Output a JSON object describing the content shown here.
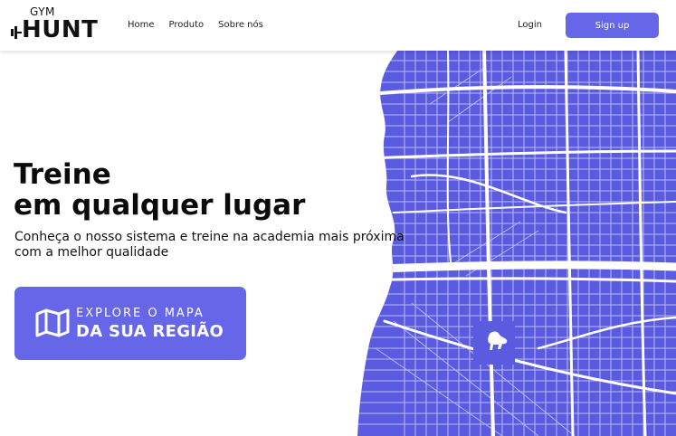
{
  "header": {
    "logo_top": "GYM",
    "logo_bottom": "HUNT",
    "nav": [
      "Home",
      "Produto",
      "Sobre nós"
    ],
    "login_label": "Login",
    "signup_label": "Sign up"
  },
  "hero": {
    "headline_line1": "Treine",
    "headline_line2": "em qualquer lugar",
    "subtitle": "Conheça o nosso sistema e treine na academia mais próxima com a melhor qualidade",
    "cta_line1": "EXPLORE O MAPA",
    "cta_line2": "DA SUA REGIÃO"
  },
  "colors": {
    "accent": "#6666e8",
    "map_land": "#5b5be0",
    "map_streets": "#ffffff"
  },
  "icons": {
    "logo": "dumbbell-icon",
    "cta": "folded-map-icon",
    "map_landmark": "horse-statue-icon"
  }
}
